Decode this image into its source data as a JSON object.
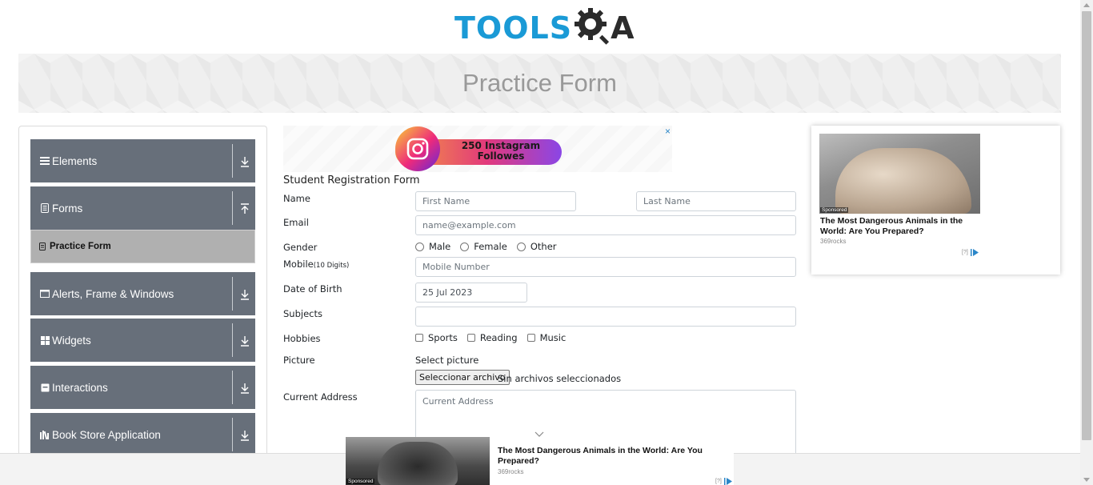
{
  "header": {
    "logo_text": "TOOLS",
    "logo_suffix": "A",
    "page_title": "Practice Form"
  },
  "sidebar": {
    "groups": [
      {
        "label": "Elements",
        "icon": "hamburger-icon"
      },
      {
        "label": "Forms",
        "icon": "document-icon"
      },
      {
        "label": "Alerts, Frame & Windows",
        "icon": "window-icon"
      },
      {
        "label": "Widgets",
        "icon": "grid-icon"
      },
      {
        "label": "Interactions",
        "icon": "square-icon"
      },
      {
        "label": "Book Store Application",
        "icon": "books-icon"
      }
    ],
    "active_item": "Practice Form"
  },
  "ad_top": {
    "text": "250 Instagram Followes",
    "close": "×"
  },
  "form": {
    "title": "Student Registration Form",
    "labels": {
      "name": "Name",
      "email": "Email",
      "gender": "Gender",
      "mobile": "Mobile",
      "mobile_hint": "(10 Digits)",
      "dob": "Date of Birth",
      "subjects": "Subjects",
      "hobbies": "Hobbies",
      "picture": "Picture",
      "address": "Current Address"
    },
    "placeholders": {
      "first_name": "First Name",
      "last_name": "Last Name",
      "email": "name@example.com",
      "mobile": "Mobile Number",
      "address": "Current Address"
    },
    "dob_value": "25 Jul 2023",
    "gender_options": [
      "Male",
      "Female",
      "Other"
    ],
    "hobby_options": [
      "Sports",
      "Reading",
      "Music"
    ],
    "picture_label": "Select picture",
    "file_button": "Seleccionar archivo",
    "file_status": "Sin archivos seleccionados"
  },
  "ad_right": {
    "sponsored": "Sponsored",
    "headline": "The Most Dangerous Animals in the World: Are You Prepared?",
    "source": "369rocks",
    "adchoice": "[?]"
  },
  "ad_bottom": {
    "sponsored": "Sponsored",
    "headline": "The Most Dangerous Animals in the World: Are You Prepared?",
    "source": "369rocks",
    "adchoice": "[?]"
  },
  "colors": {
    "brand_blue": "#1a9ad6",
    "sidebar_group": "#676f7a",
    "active_item": "#b0b0b0"
  }
}
